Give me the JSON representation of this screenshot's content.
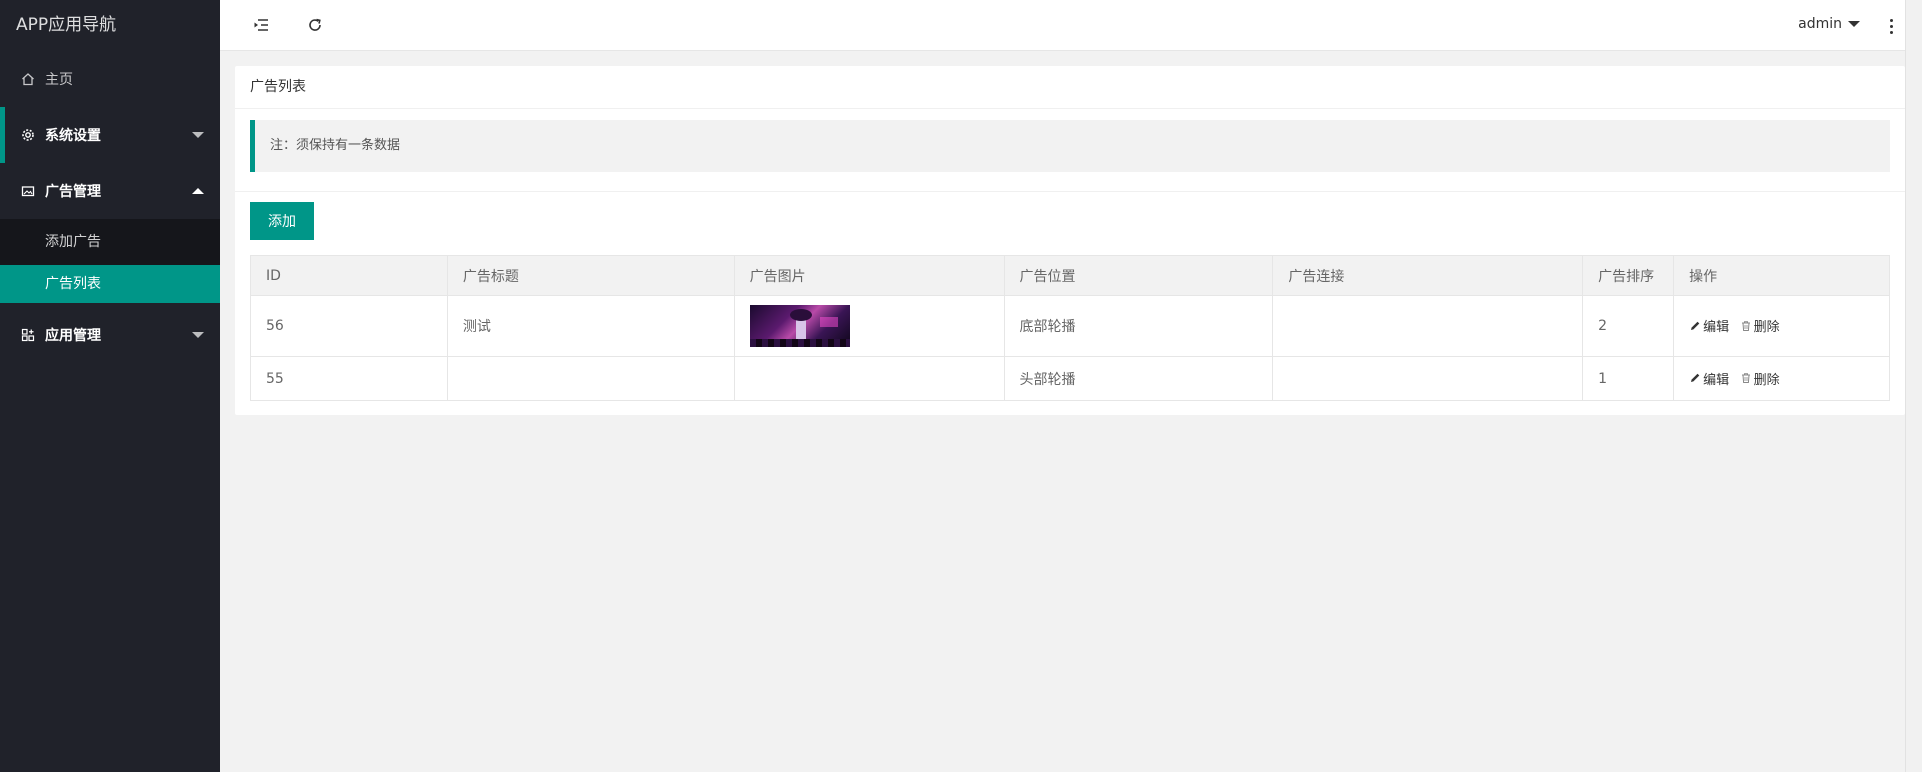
{
  "app": {
    "title": "APP应用导航"
  },
  "sidebar": {
    "items": [
      {
        "label": "主页",
        "icon": "home-icon"
      },
      {
        "label": "系统设置",
        "icon": "gear-icon"
      },
      {
        "label": "广告管理",
        "icon": "image-icon"
      },
      {
        "label": "应用管理",
        "icon": "apps-icon"
      }
    ],
    "submenu": [
      {
        "label": "添加广告"
      },
      {
        "label": "广告列表"
      }
    ]
  },
  "header": {
    "user": "admin"
  },
  "card": {
    "title": "广告列表",
    "notice": "注：须保持有一条数据",
    "add_label": "添加"
  },
  "table": {
    "columns": [
      "ID",
      "广告标题",
      "广告图片",
      "广告位置",
      "广告连接",
      "广告排序",
      "操作"
    ],
    "rows": [
      {
        "id": "56",
        "title": "测试",
        "has_image": true,
        "position": "底部轮播",
        "link": "",
        "order": "2"
      },
      {
        "id": "55",
        "title": "",
        "has_image": false,
        "position": "头部轮播",
        "link": "",
        "order": "1"
      }
    ],
    "edit_label": "编辑",
    "delete_label": "删除"
  },
  "colors": {
    "accent": "#009688",
    "sidebar": "#20222a",
    "submenu": "#15161b"
  }
}
